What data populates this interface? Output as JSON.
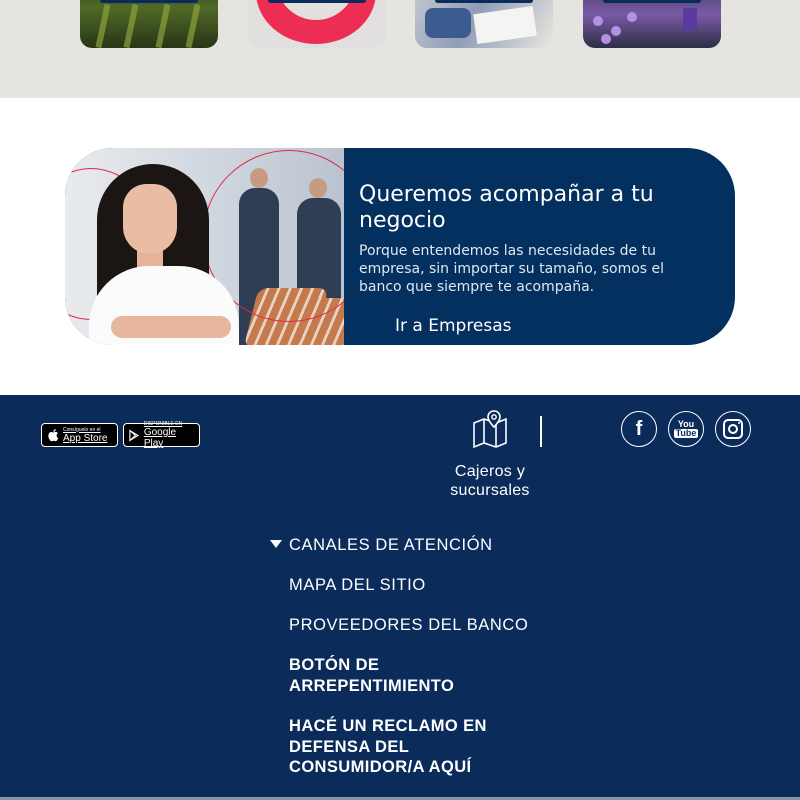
{
  "promo": {
    "title": "Queremos acompañar a tu negocio",
    "text": "Porque entendemos las necesidades de tu empresa, sin importar su tamaño, somos el banco que siempre te acompaña.",
    "link": "Ir a Empresas"
  },
  "footer": {
    "app_store": {
      "small": "Consíguelo en el",
      "big": "App Store"
    },
    "google_play": {
      "small": "DISPONIBLE EN",
      "big": "Google Play"
    },
    "atm_label": "Cajeros y sucursales",
    "social": {
      "facebook_glyph": "f",
      "youtube_you": "You",
      "youtube_tube": "Tube"
    },
    "menu": [
      "CANALES DE ATENCIÓN",
      "MAPA DEL SITIO",
      "PROVEEDORES DEL BANCO",
      "BOTÓN DE ARREPENTIMIENTO",
      "HACÉ UN RECLAMO EN DEFENSA DEL CONSUMIDOR/A AQUÍ"
    ]
  },
  "colors": {
    "brand_navy": "#0b2c5a",
    "promo_navy": "#03305e",
    "accent_red": "#ee2d54",
    "top_band": "#e6e4e0"
  },
  "icons": [
    "apple-icon",
    "google-play-icon",
    "map-pin-icon",
    "facebook-icon",
    "youtube-icon",
    "instagram-icon",
    "caret-down-icon"
  ]
}
